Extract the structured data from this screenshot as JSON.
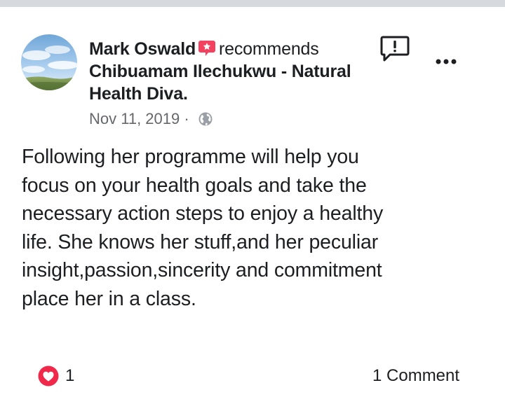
{
  "post": {
    "author": "Mark Oswald",
    "action": "recommends",
    "page_name_line1": "Chibuamam Ilechukwu - Natural",
    "page_name_line2": "Health Diva.",
    "date": "Nov 11, 2019",
    "separator": "·",
    "privacy_icon": "globe-icon",
    "body": "Following her programme will help you\nfocus on your health goals and take the\nnecessary action steps to enjoy a healthy\nlife. She knows her stuff,and her peculiar\ninsight,passion,sincerity and commitment\nplace her in a class.",
    "reaction_count": "1",
    "comments_label": "1 Comment"
  },
  "icons": {
    "recommend": "recommend-badge-icon",
    "report": "report-icon",
    "more": "more-options-icon",
    "reaction": "love-reaction-icon"
  },
  "colors": {
    "recommend_badge": "#f3425f",
    "reaction": "#f0284a",
    "meta_text": "#65676b",
    "primary_text": "#1c1e21"
  }
}
